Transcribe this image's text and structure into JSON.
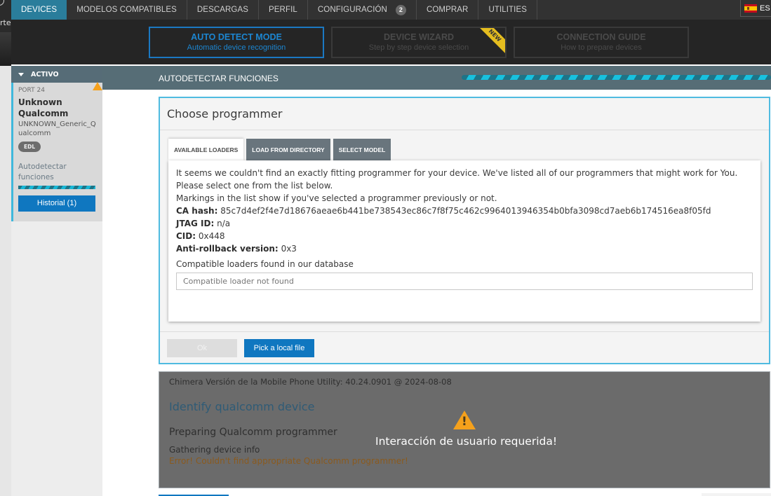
{
  "background_app": {
    "partial_text": "rte"
  },
  "topnav": {
    "items": [
      {
        "label": "DEVICES",
        "active": true
      },
      {
        "label": "MODELOS COMPATIBLES"
      },
      {
        "label": "DESCARGAS"
      },
      {
        "label": "PERFIL"
      },
      {
        "label": "CONFIGURACIÓN",
        "badge": "2"
      },
      {
        "label": "COMPRAR"
      },
      {
        "label": "UTILITIES"
      }
    ],
    "language": {
      "code": "ES",
      "icon": "spain-flag-icon"
    }
  },
  "modes": [
    {
      "title": "AUTO DETECT MODE",
      "subtitle": "Automatic device recognition",
      "active": true
    },
    {
      "title": "DEVICE WIZARD",
      "subtitle": "Step by step device selection",
      "ribbon": "NEW"
    },
    {
      "title": "CONNECTION GUIDE",
      "subtitle": "How to prepare devices"
    }
  ],
  "sidebar": {
    "section_label": "ACTIVO",
    "device": {
      "port": "PORT 24",
      "name": "Unknown Qualcomm",
      "model": "UNKNOWN_Generic_Qualcomm",
      "mode_badge": "EDL",
      "status": "Autodetectar funciones",
      "history_button": "Historial (1)",
      "warning_icon": "warning-icon"
    }
  },
  "section": {
    "title": "AUTODETECTAR FUNCIONES"
  },
  "dialog": {
    "title": "Choose programmer",
    "tabs": [
      {
        "label": "AVAILABLE LOADERS",
        "active": true
      },
      {
        "label": "LOAD FROM DIRECTORY"
      },
      {
        "label": "SELECT MODEL"
      }
    ],
    "intro_lines": [
      "It seems we couldn't find an exactly fitting programmer for your device. We've listed all of our programmers that might work for You.",
      "Please select one from the list below.",
      "Markings in the list show if you've selected a programmer previously or not."
    ],
    "fields": [
      {
        "key": "CA hash:",
        "value": "85c7d4ef2f4e7d18676aeae6b441be738543ec86c7f8f75c462c9964013946354b0bfa3098cd7aeb6b174516ea8f05fd"
      },
      {
        "key": "JTAG ID:",
        "value": "n/a"
      },
      {
        "key": "CID:",
        "value": "0x448"
      },
      {
        "key": "Anti-rollback version:",
        "value": "0x3"
      }
    ],
    "loaders_label": "Compatible loaders found in our database",
    "loader_placeholder": "Compatible loader not found",
    "ok_button": "Ok",
    "pick_button": "Pick a local file"
  },
  "log": {
    "version_line": "Chimera Versión de la Mobile Phone Utility: 40.24.0901 @ 2024-08-08",
    "operation": "Identify qualcomm device",
    "step": "Preparing Qualcomm programmer",
    "line": "Gathering device info",
    "error": "Error! Couldn't find appropriate Qualcomm programmer!",
    "overlay_message": "Interacción de usuario requerida!"
  },
  "colors": {
    "accent": "#2a7d9b",
    "primary_button": "#0f77c0",
    "dialog_border": "#4fbbe0",
    "warning": "#f5a11c",
    "error_text": "#8a5a1e"
  }
}
